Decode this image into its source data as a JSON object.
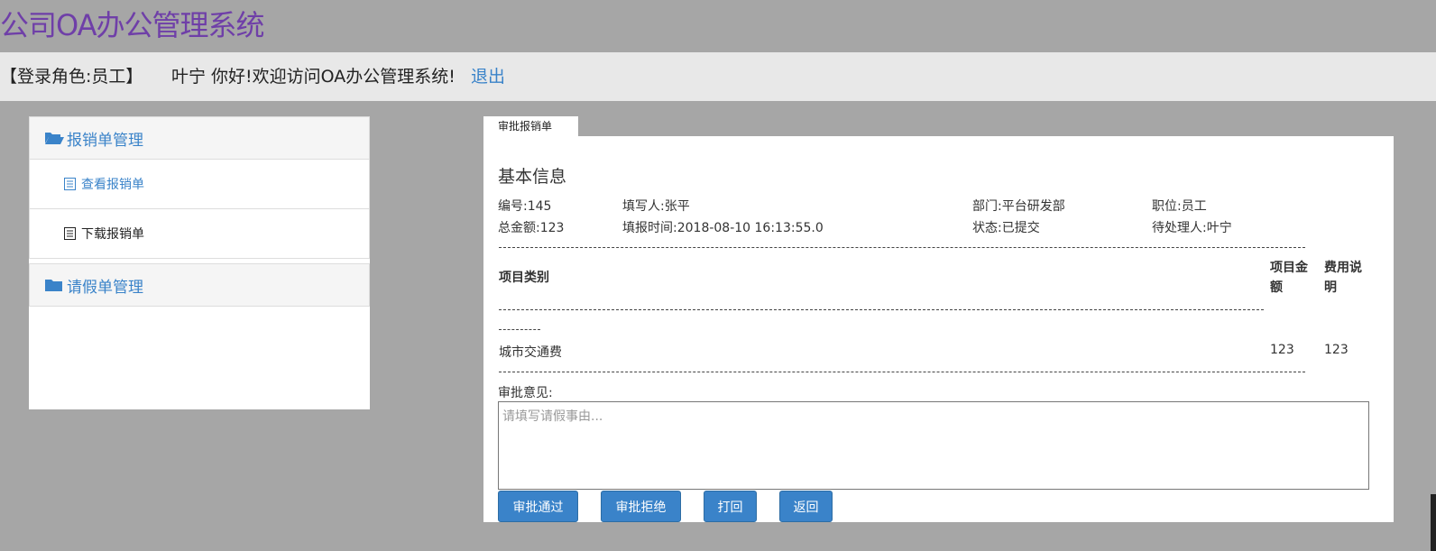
{
  "header": {
    "title": "公司OA办公管理系统"
  },
  "userbar": {
    "role": "【登录角色:员工】",
    "greeting": "叶宁 你好!欢迎访问OA办公管理系统!",
    "logout": "退出"
  },
  "sidebar": {
    "groups": [
      {
        "label": "报销单管理",
        "icon": "folder-open-icon",
        "items": [
          {
            "label": "查看报销单",
            "icon": "list-icon"
          },
          {
            "label": "下载报销单",
            "icon": "list-icon"
          }
        ]
      },
      {
        "label": "请假单管理",
        "icon": "folder-icon"
      }
    ]
  },
  "tab": {
    "label": "审批报销单"
  },
  "info": {
    "section_title": "基本信息",
    "number": "编号:145",
    "filler": "填写人:张平",
    "department": "部门:平台研发部",
    "position": "职位:员工",
    "total": "总金额:123",
    "fill_time": "填报时间:2018-08-10 16:13:55.0",
    "status": "状态:已提交",
    "handler": "待处理人:叶宁"
  },
  "table": {
    "headers": {
      "category": "项目类别",
      "amount_line1": "项目金",
      "amount_line2": "额",
      "note_line1": "费用说",
      "note_line2": "明"
    },
    "rows": [
      {
        "category": "城市交通费",
        "amount": "123",
        "note": "123"
      }
    ]
  },
  "approval": {
    "label": "审批意见:",
    "placeholder": "请填写请假事由..."
  },
  "buttons": {
    "approve": "审批通过",
    "reject": "审批拒绝",
    "return_back": "打回",
    "go_back": "返回"
  },
  "colors": {
    "background": "#a6a6a6",
    "title": "#6f3fa8",
    "accent": "#3a83c9"
  }
}
